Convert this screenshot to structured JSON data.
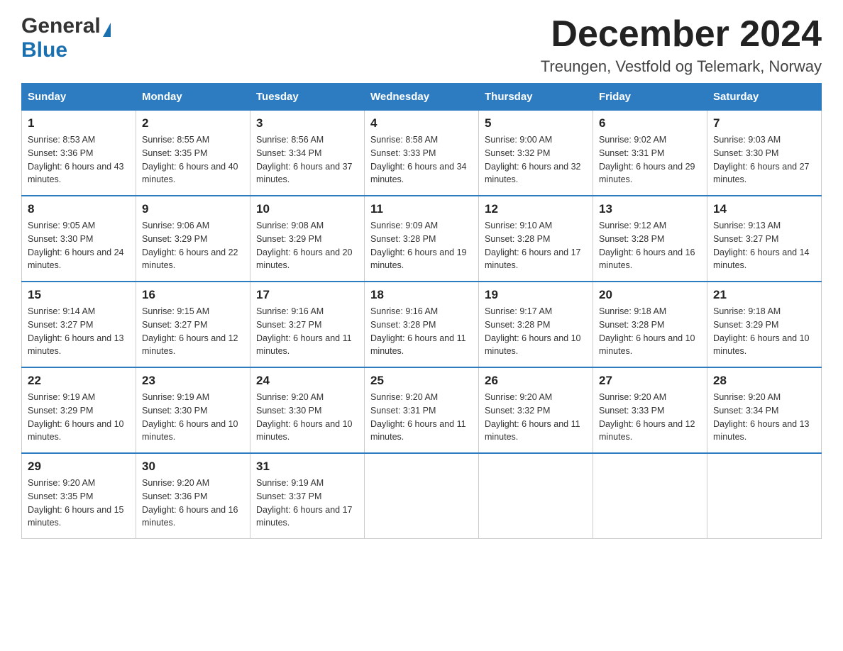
{
  "header": {
    "logo_general": "General",
    "logo_blue": "Blue",
    "month_title": "December 2024",
    "location": "Treungen, Vestfold og Telemark, Norway"
  },
  "weekdays": [
    "Sunday",
    "Monday",
    "Tuesday",
    "Wednesday",
    "Thursday",
    "Friday",
    "Saturday"
  ],
  "weeks": [
    [
      {
        "day": "1",
        "sunrise": "8:53 AM",
        "sunset": "3:36 PM",
        "daylight": "6 hours and 43 minutes."
      },
      {
        "day": "2",
        "sunrise": "8:55 AM",
        "sunset": "3:35 PM",
        "daylight": "6 hours and 40 minutes."
      },
      {
        "day": "3",
        "sunrise": "8:56 AM",
        "sunset": "3:34 PM",
        "daylight": "6 hours and 37 minutes."
      },
      {
        "day": "4",
        "sunrise": "8:58 AM",
        "sunset": "3:33 PM",
        "daylight": "6 hours and 34 minutes."
      },
      {
        "day": "5",
        "sunrise": "9:00 AM",
        "sunset": "3:32 PM",
        "daylight": "6 hours and 32 minutes."
      },
      {
        "day": "6",
        "sunrise": "9:02 AM",
        "sunset": "3:31 PM",
        "daylight": "6 hours and 29 minutes."
      },
      {
        "day": "7",
        "sunrise": "9:03 AM",
        "sunset": "3:30 PM",
        "daylight": "6 hours and 27 minutes."
      }
    ],
    [
      {
        "day": "8",
        "sunrise": "9:05 AM",
        "sunset": "3:30 PM",
        "daylight": "6 hours and 24 minutes."
      },
      {
        "day": "9",
        "sunrise": "9:06 AM",
        "sunset": "3:29 PM",
        "daylight": "6 hours and 22 minutes."
      },
      {
        "day": "10",
        "sunrise": "9:08 AM",
        "sunset": "3:29 PM",
        "daylight": "6 hours and 20 minutes."
      },
      {
        "day": "11",
        "sunrise": "9:09 AM",
        "sunset": "3:28 PM",
        "daylight": "6 hours and 19 minutes."
      },
      {
        "day": "12",
        "sunrise": "9:10 AM",
        "sunset": "3:28 PM",
        "daylight": "6 hours and 17 minutes."
      },
      {
        "day": "13",
        "sunrise": "9:12 AM",
        "sunset": "3:28 PM",
        "daylight": "6 hours and 16 minutes."
      },
      {
        "day": "14",
        "sunrise": "9:13 AM",
        "sunset": "3:27 PM",
        "daylight": "6 hours and 14 minutes."
      }
    ],
    [
      {
        "day": "15",
        "sunrise": "9:14 AM",
        "sunset": "3:27 PM",
        "daylight": "6 hours and 13 minutes."
      },
      {
        "day": "16",
        "sunrise": "9:15 AM",
        "sunset": "3:27 PM",
        "daylight": "6 hours and 12 minutes."
      },
      {
        "day": "17",
        "sunrise": "9:16 AM",
        "sunset": "3:27 PM",
        "daylight": "6 hours and 11 minutes."
      },
      {
        "day": "18",
        "sunrise": "9:16 AM",
        "sunset": "3:28 PM",
        "daylight": "6 hours and 11 minutes."
      },
      {
        "day": "19",
        "sunrise": "9:17 AM",
        "sunset": "3:28 PM",
        "daylight": "6 hours and 10 minutes."
      },
      {
        "day": "20",
        "sunrise": "9:18 AM",
        "sunset": "3:28 PM",
        "daylight": "6 hours and 10 minutes."
      },
      {
        "day": "21",
        "sunrise": "9:18 AM",
        "sunset": "3:29 PM",
        "daylight": "6 hours and 10 minutes."
      }
    ],
    [
      {
        "day": "22",
        "sunrise": "9:19 AM",
        "sunset": "3:29 PM",
        "daylight": "6 hours and 10 minutes."
      },
      {
        "day": "23",
        "sunrise": "9:19 AM",
        "sunset": "3:30 PM",
        "daylight": "6 hours and 10 minutes."
      },
      {
        "day": "24",
        "sunrise": "9:20 AM",
        "sunset": "3:30 PM",
        "daylight": "6 hours and 10 minutes."
      },
      {
        "day": "25",
        "sunrise": "9:20 AM",
        "sunset": "3:31 PM",
        "daylight": "6 hours and 11 minutes."
      },
      {
        "day": "26",
        "sunrise": "9:20 AM",
        "sunset": "3:32 PM",
        "daylight": "6 hours and 11 minutes."
      },
      {
        "day": "27",
        "sunrise": "9:20 AM",
        "sunset": "3:33 PM",
        "daylight": "6 hours and 12 minutes."
      },
      {
        "day": "28",
        "sunrise": "9:20 AM",
        "sunset": "3:34 PM",
        "daylight": "6 hours and 13 minutes."
      }
    ],
    [
      {
        "day": "29",
        "sunrise": "9:20 AM",
        "sunset": "3:35 PM",
        "daylight": "6 hours and 15 minutes."
      },
      {
        "day": "30",
        "sunrise": "9:20 AM",
        "sunset": "3:36 PM",
        "daylight": "6 hours and 16 minutes."
      },
      {
        "day": "31",
        "sunrise": "9:19 AM",
        "sunset": "3:37 PM",
        "daylight": "6 hours and 17 minutes."
      },
      null,
      null,
      null,
      null
    ]
  ]
}
